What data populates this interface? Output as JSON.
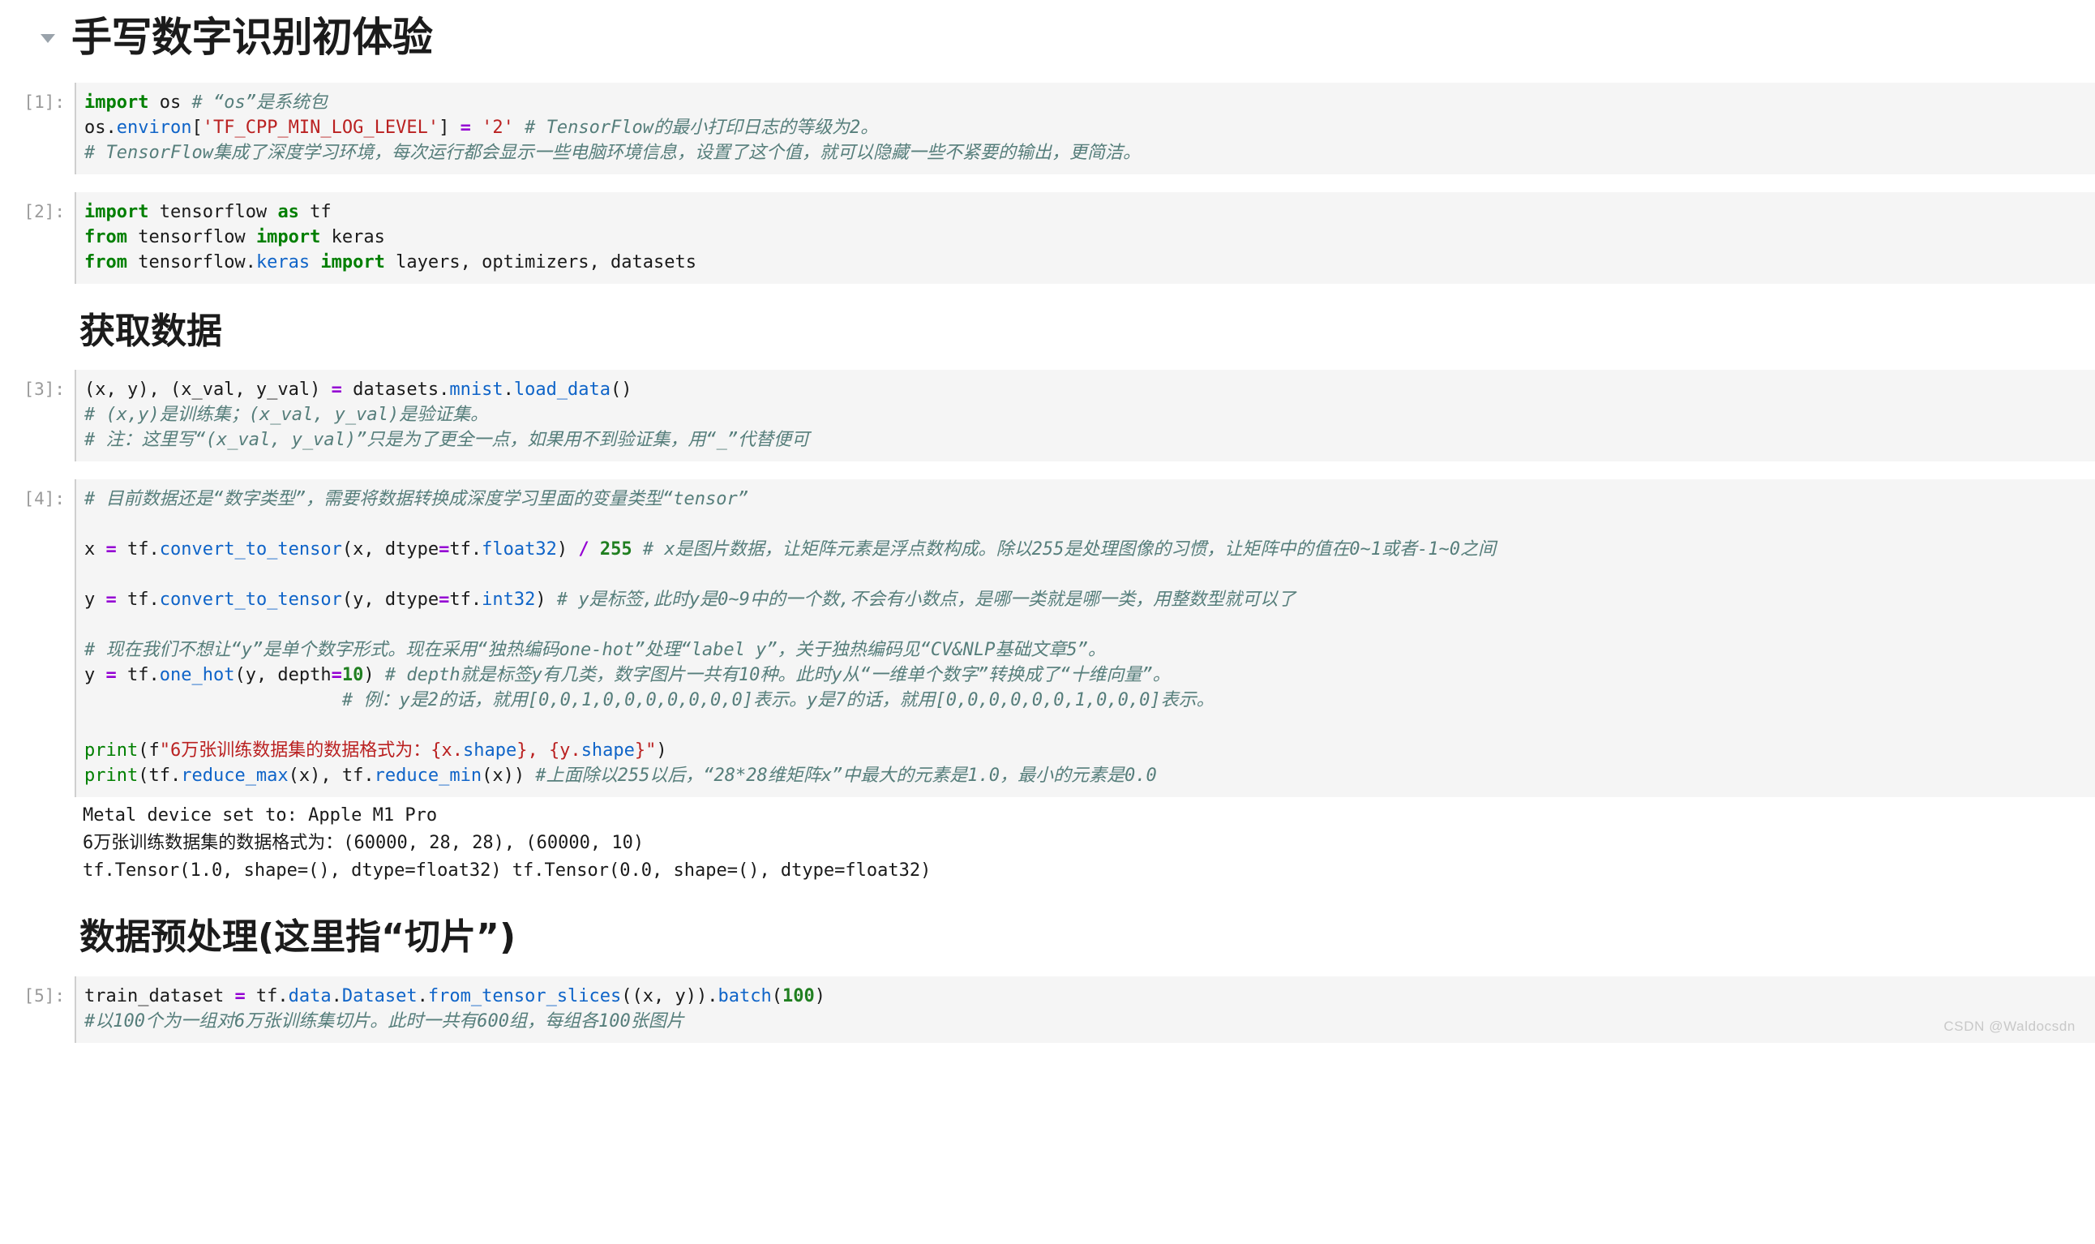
{
  "watermark": "CSDN @Waldocsdn",
  "headings": {
    "h1": "手写数字识别初体验",
    "section_get_data": "获取数据",
    "section_preprocess": "数据预处理(这里指“切片”)"
  },
  "prompts": {
    "cell1": "[1]:",
    "cell2": "[2]:",
    "cell3": "[3]:",
    "cell4": "[4]:",
    "cell5": "[5]:"
  },
  "cells": {
    "cell1": {
      "line1_kw": "import",
      "line1_mod": " os ",
      "line1_comment": "# “os”是系统包",
      "line2_obj": "os.",
      "line2_attr": "environ",
      "line2_br1": "[",
      "line2_key": "'TF_CPP_MIN_LOG_LEVEL'",
      "line2_br2": "] ",
      "line2_eq": "=",
      "line2_val": " '2' ",
      "line2_comment": "# TensorFlow的最小打印日志的等级为2。",
      "line3_comment": "# TensorFlow集成了深度学习环境，每次运行都会显示一些电脑环境信息，设置了这个值，就可以隐藏一些不紧要的输出，更简洁。"
    },
    "cell2": {
      "l1_kw1": "import",
      "l1_t1": " tensorflow ",
      "l1_kw2": "as",
      "l1_t2": " tf",
      "l2_kw1": "from",
      "l2_t1": " tensorflow ",
      "l2_kw2": "import",
      "l2_t2": " keras",
      "l3_kw1": "from",
      "l3_t1": " tensorflow.",
      "l3_mod": "keras",
      "l3_kw2": " import",
      "l3_t2": " layers, optimizers, datasets"
    },
    "cell3": {
      "l1_a": "(x, y), (x_val, y_val) ",
      "l1_eq": "=",
      "l1_b": " datasets.",
      "l1_f1": "mnist",
      "l1_dot": ".",
      "l1_f2": "load_data",
      "l1_c": "()",
      "l2_comment": "# (x,y)是训练集；(x_val, y_val)是验证集。",
      "l3_comment": "# 注：这里写“(x_val, y_val)”只是为了更全一点，如果用不到验证集，用“_”代替便可"
    },
    "cell4": {
      "l1_comment": "# 目前数据还是“数字类型”，需要将数据转换成深度学习里面的变量类型“tensor”",
      "l3_x": "x ",
      "l3_eq": "=",
      "l3_a": " tf.",
      "l3_f": "convert_to_tensor",
      "l3_b": "(x, dtype",
      "l3_eq2": "=",
      "l3_c": "tf.",
      "l3_type": "float32",
      "l3_d": ") ",
      "l3_div": "/",
      "l3_e": " ",
      "l3_num": "255",
      "l3_comment": " # x是图片数据，让矩阵元素是浮点数构成。除以255是处理图像的习惯，让矩阵中的值在0~1或者-1~0之间",
      "l5_y": "y ",
      "l5_eq": "=",
      "l5_a": " tf.",
      "l5_f": "convert_to_tensor",
      "l5_b": "(y, dtype",
      "l5_eq2": "=",
      "l5_c": "tf.",
      "l5_type": "int32",
      "l5_d": ") ",
      "l5_comment": "# y是标签,此时y是0~9中的一个数,不会有小数点，是哪一类就是哪一类，用整数型就可以了",
      "l7_comment": "# 现在我们不想让“y”是单个数字形式。现在采用“独热编码one-hot”处理“label y”，关于独热编码见“CV&NLP基础文章5”。",
      "l8_y": "y ",
      "l8_eq": "=",
      "l8_a": " tf.",
      "l8_f": "one_hot",
      "l8_b": "(y, depth",
      "l8_eq2": "=",
      "l8_num": "10",
      "l8_c": ") ",
      "l8_comment": "# depth就是标签y有几类，数字图片一共有10种。此时y从“一维单个数字”转换成了“十维向量”。",
      "l9_comment": "                        # 例：y是2的话，就用[0,0,1,0,0,0,0,0,0,0]表示。y是7的话，就用[0,0,0,0,0,0,1,0,0,0]表示。",
      "l11_p": "print",
      "l11_a": "(f",
      "l11_s1": "\"6万张训练数据集的数据格式为：{x.",
      "l11_f1": "shape",
      "l11_s2": "}, {y.",
      "l11_f2": "shape",
      "l11_s3": "}\"",
      "l11_b": ")",
      "l12_p": "print",
      "l12_a": "(tf.",
      "l12_f1": "reduce_max",
      "l12_b": "(x), tf.",
      "l12_f2": "reduce_min",
      "l12_c": "(x)) ",
      "l12_comment": "#上面除以255以后，“28*28维矩阵x”中最大的元素是1.0，最小的元素是0.0"
    },
    "cell4_output": {
      "line1": "Metal device set to: Apple M1 Pro",
      "line2": "6万张训练数据集的数据格式为：(60000, 28, 28), (60000, 10)",
      "line3": "tf.Tensor(1.0, shape=(), dtype=float32) tf.Tensor(0.0, shape=(), dtype=float32)"
    },
    "cell5": {
      "l1_a": "train_dataset ",
      "l1_eq": "=",
      "l1_b": " tf.",
      "l1_f1": "data",
      "l1_c": ".",
      "l1_f2": "Dataset",
      "l1_d": ".",
      "l1_f3": "from_tensor_slices",
      "l1_e": "((x, y)).",
      "l1_f4": "batch",
      "l1_f": "(",
      "l1_num": "100",
      "l1_g": ")",
      "l2_comment": "#以100个为一组对6万张训练集切片。此时一共有600组，每组各100张图片"
    }
  }
}
